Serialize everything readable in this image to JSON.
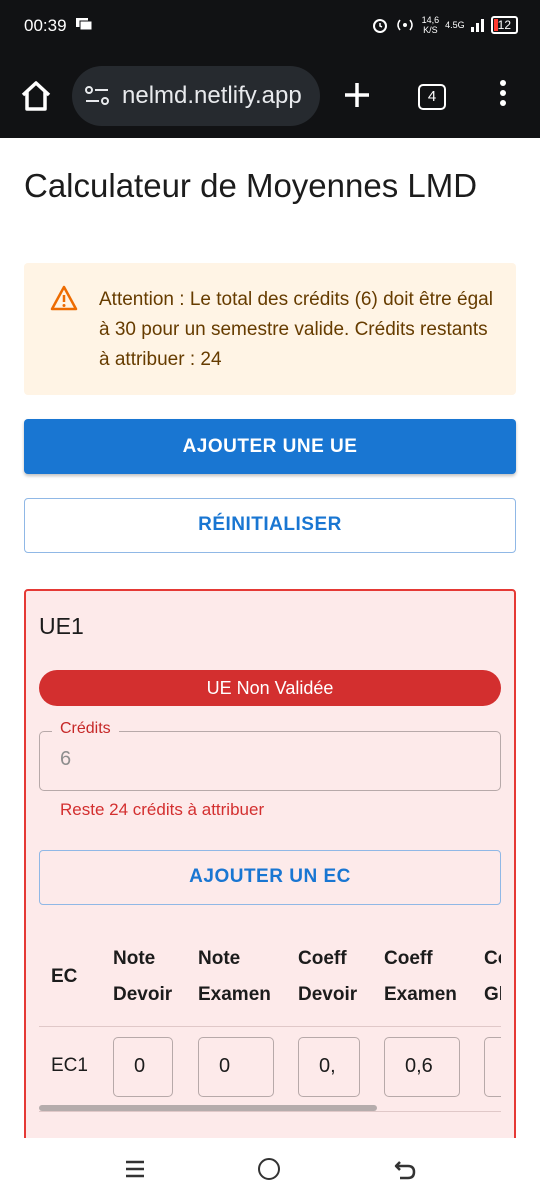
{
  "status": {
    "time": "00:39",
    "net_speed_top": "14,6",
    "net_speed_bottom": "K/S",
    "network": "4.5G",
    "battery": "12"
  },
  "browser": {
    "url": "nelmd.netlify.app",
    "tab_count": "4"
  },
  "page": {
    "title": "Calculateur de Moyennes LMD",
    "alert": {
      "color": "#fff4e5",
      "text": "Attention : Le total des crédits (6) doit être égal à 30 pour un semestre valide. Crédits restants à attribuer : 24"
    },
    "add_ue_label": "AJOUTER UNE UE",
    "reset_label": "RÉINITIALISER",
    "ue": {
      "title": "UE1",
      "status_badge": "UE Non Validée",
      "status_color": "#d32f2f",
      "credits_label": "Crédits",
      "credits_value": "6",
      "credits_helper": "Reste 24 crédits à attribuer",
      "add_ec_label": "AJOUTER UN EC",
      "table": {
        "headers": {
          "ec": "EC",
          "note_devoir_1": "Note",
          "note_devoir_2": "Devoir",
          "note_examen_1": "Note",
          "note_examen_2": "Examen",
          "coeff_devoir_1": "Coeff",
          "coeff_devoir_2": "Devoir",
          "coeff_examen_1": "Coeff",
          "coeff_examen_2": "Examen",
          "coeff_global_1": "Co",
          "coeff_global_2": "Gl"
        },
        "rows": [
          {
            "ec": "EC1",
            "note_devoir": "0",
            "note_examen": "0",
            "coeff_devoir": "0,",
            "coeff_examen": "0,6"
          }
        ]
      }
    }
  }
}
